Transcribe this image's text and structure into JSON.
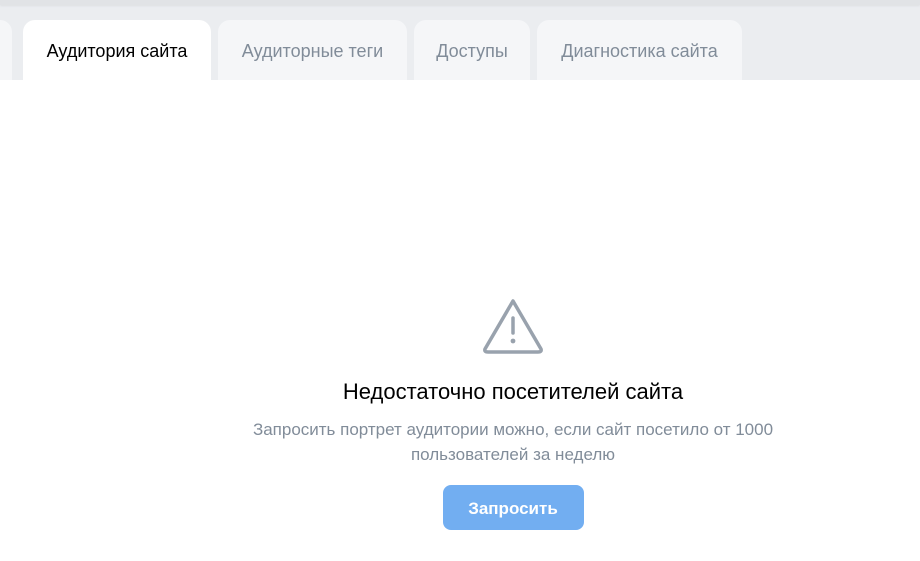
{
  "tabs": {
    "audience": "Аудитория сайта",
    "tags": "Аудиторные теги",
    "access": "Доступы",
    "diagnostics": "Диагностика сайта"
  },
  "empty_state": {
    "icon": "warning-triangle-icon",
    "title": "Недостаточно посетителей сайта",
    "description": "Запросить портрет аудитории можно, если сайт посетило от 1000 пользователей за неделю",
    "button_label": "Запросить"
  },
  "colors": {
    "accent": "#72aef1",
    "muted_text": "#818c99",
    "tab_bar": "#ebedf0"
  }
}
